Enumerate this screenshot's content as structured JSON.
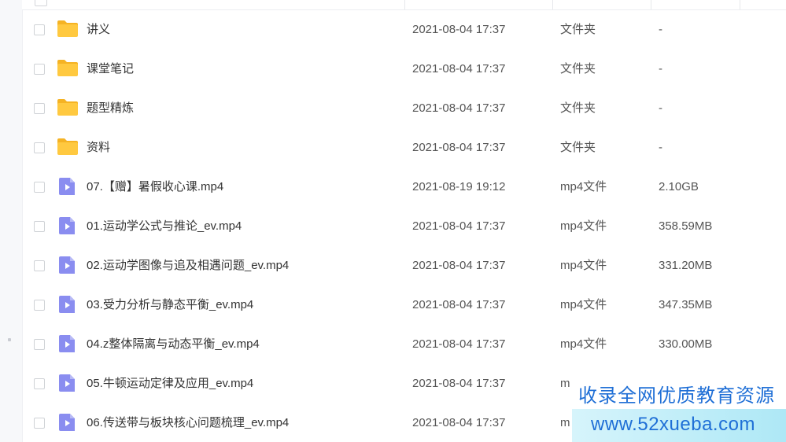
{
  "files": [
    {
      "name": "讲义",
      "kind": "folder",
      "mtime": "2021-08-04 17:37",
      "type": "文件夹",
      "size": "-"
    },
    {
      "name": "课堂笔记",
      "kind": "folder",
      "mtime": "2021-08-04 17:37",
      "type": "文件夹",
      "size": "-"
    },
    {
      "name": "题型精炼",
      "kind": "folder",
      "mtime": "2021-08-04 17:37",
      "type": "文件夹",
      "size": "-"
    },
    {
      "name": "资料",
      "kind": "folder",
      "mtime": "2021-08-04 17:37",
      "type": "文件夹",
      "size": "-"
    },
    {
      "name": "07.【赠】暑假收心课.mp4",
      "kind": "video",
      "mtime": "2021-08-19 19:12",
      "type": "mp4文件",
      "size": "2.10GB"
    },
    {
      "name": "01.运动学公式与推论_ev.mp4",
      "kind": "video",
      "mtime": "2021-08-04 17:37",
      "type": "mp4文件",
      "size": "358.59MB"
    },
    {
      "name": "02.运动学图像与追及相遇问题_ev.mp4",
      "kind": "video",
      "mtime": "2021-08-04 17:37",
      "type": "mp4文件",
      "size": "331.20MB"
    },
    {
      "name": "03.受力分析与静态平衡_ev.mp4",
      "kind": "video",
      "mtime": "2021-08-04 17:37",
      "type": "mp4文件",
      "size": "347.35MB"
    },
    {
      "name": "04.z整体隔离与动态平衡_ev.mp4",
      "kind": "video",
      "mtime": "2021-08-04 17:37",
      "type": "mp4文件",
      "size": "330.00MB"
    },
    {
      "name": "05.牛顿运动定律及应用_ev.mp4",
      "kind": "video",
      "mtime": "2021-08-04 17:37",
      "type": "m",
      "size": ""
    },
    {
      "name": "06.传送带与板块核心问题梳理_ev.mp4",
      "kind": "video",
      "mtime": "2021-08-04 17:37",
      "type": "m",
      "size": ""
    }
  ],
  "icons": {
    "folder": "folder-icon",
    "video": "video-file-icon"
  },
  "colors": {
    "folder": "#ffc940",
    "folder_tab": "#f5b324",
    "video": "#8a8df0",
    "watermark_text": "#1f6fd6"
  },
  "watermark": {
    "line1": "收录全网优质教育资源",
    "line2": "www.52xueba.com"
  }
}
